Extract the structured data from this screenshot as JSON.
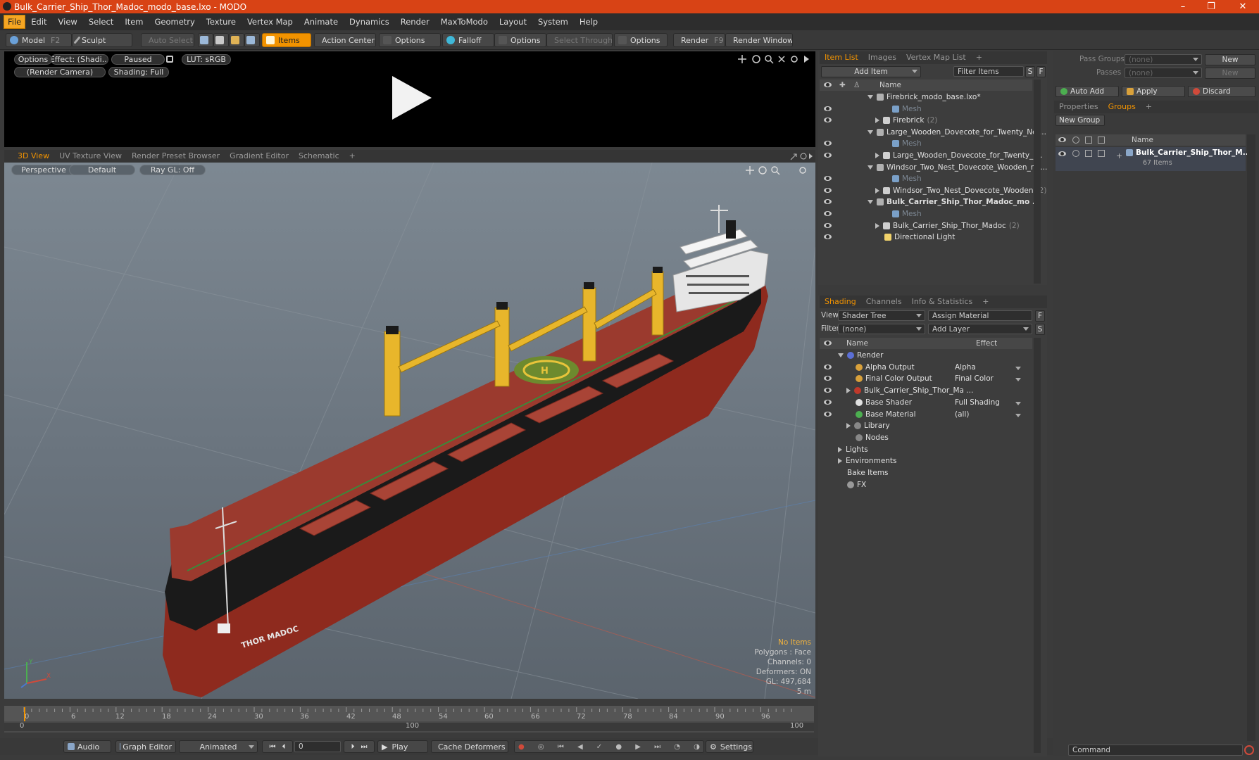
{
  "window": {
    "title": "Bulk_Carrier_Ship_Thor_Madoc_modo_base.lxo - MODO",
    "controls": [
      "–",
      "❐",
      "✕"
    ]
  },
  "menu": [
    "File",
    "Edit",
    "View",
    "Select",
    "Item",
    "Geometry",
    "Texture",
    "Vertex Map",
    "Animate",
    "Dynamics",
    "Render",
    "MaxToModo",
    "Layout",
    "System",
    "Help"
  ],
  "toolbar": {
    "model": "Model",
    "model_key": "F2",
    "sculpt": "Sculpt",
    "auto_select": "Auto Select",
    "items": "Items",
    "action_center": "Action Center",
    "options1": "Options",
    "falloff": "Falloff",
    "options2": "Options",
    "select_through": "Select Through",
    "options3": "Options",
    "render": "Render",
    "render_key": "F9",
    "render_window": "Render Window"
  },
  "preview": {
    "options": "Options",
    "effect": "Effect: (Shadi...",
    "paused": "Paused",
    "lut": "LUT: sRGB",
    "camera": "(Render Camera)",
    "shading": "Shading: Full"
  },
  "view_tabs": [
    "3D View",
    "UV Texture View",
    "Render Preset Browser",
    "Gradient Editor",
    "Schematic",
    "+"
  ],
  "viewport": {
    "perspective": "Perspective",
    "default": "Default",
    "raygl": "Ray GL: Off",
    "ship_name": "THOR MADOC",
    "stats": {
      "no_items": "No Items",
      "polygons": "Polygons : Face",
      "channels": "Channels: 0",
      "deformers": "Deformers: ON",
      "gl": "GL: 497,684",
      "scale": "5 m"
    },
    "axis": {
      "y": "Y",
      "x": "X"
    }
  },
  "timeline": {
    "ticks": [
      "0",
      "6",
      "12",
      "18",
      "24",
      "30",
      "36",
      "42",
      "48",
      "54",
      "60",
      "66",
      "72",
      "78",
      "84",
      "90",
      "96"
    ],
    "range_start": "0",
    "range_mid": "100",
    "range_end": "100"
  },
  "bottombar": {
    "audio": "Audio",
    "graph_editor": "Graph Editor",
    "animated": "Animated",
    "frame": "0",
    "play": "Play",
    "cache_deformers": "Cache Deformers",
    "settings": "Settings"
  },
  "item_list": {
    "tabs": [
      "Item List",
      "Images",
      "Vertex Map List",
      "+"
    ],
    "add_item": "Add Item",
    "filter_items": "Filter Items",
    "s": "S",
    "f": "F",
    "col_name": "Name",
    "rows": [
      {
        "label": "Firebrick_modo_base.lxo*",
        "count": "",
        "level": 0,
        "type": "scene",
        "eye": false,
        "exp": "down"
      },
      {
        "label": "Mesh",
        "count": "",
        "level": 2,
        "type": "mesh",
        "eye": true,
        "exp": ""
      },
      {
        "label": "Firebrick",
        "count": "(2)",
        "level": 1,
        "type": "group",
        "eye": true,
        "exp": "right"
      },
      {
        "label": "Large_Wooden_Dovecote_for_Twenty_Ne ...",
        "count": "",
        "level": 0,
        "type": "scene",
        "eye": false,
        "exp": "down"
      },
      {
        "label": "Mesh",
        "count": "",
        "level": 2,
        "type": "mesh",
        "eye": true,
        "exp": ""
      },
      {
        "label": "Large_Wooden_Dovecote_for_Twenty_ ...",
        "count": "",
        "level": 1,
        "type": "group",
        "eye": true,
        "exp": "right"
      },
      {
        "label": "Windsor_Two_Nest_Dovecote_Wooden_m ...",
        "count": "",
        "level": 0,
        "type": "scene",
        "eye": false,
        "exp": "down"
      },
      {
        "label": "Mesh",
        "count": "",
        "level": 2,
        "type": "mesh",
        "eye": true,
        "exp": ""
      },
      {
        "label": "Windsor_Two_Nest_Dovecote_Wooden",
        "count": "(2)",
        "level": 1,
        "type": "group",
        "eye": true,
        "exp": "right"
      },
      {
        "label": "Bulk_Carrier_Ship_Thor_Madoc_mo ...",
        "count": "",
        "level": 0,
        "type": "scene",
        "eye": true,
        "exp": "down",
        "bold": true
      },
      {
        "label": "Mesh",
        "count": "",
        "level": 2,
        "type": "mesh",
        "eye": true,
        "exp": ""
      },
      {
        "label": "Bulk_Carrier_Ship_Thor_Madoc",
        "count": "(2)",
        "level": 1,
        "type": "group",
        "eye": true,
        "exp": "right"
      },
      {
        "label": "Directional Light",
        "count": "",
        "level": 1,
        "type": "light",
        "eye": true,
        "exp": ""
      }
    ]
  },
  "shading": {
    "tabs": [
      "Shading",
      "Channels",
      "Info & Statistics",
      "+"
    ],
    "view_label": "View",
    "view_value": "Shader Tree",
    "assign_material": "Assign Material",
    "f": "F",
    "filter_label": "Filter",
    "filter_value": "(none)",
    "add_layer": "Add Layer",
    "s": "S",
    "col_name": "Name",
    "col_effect": "Effect",
    "rows": [
      {
        "label": "Render",
        "effect": "",
        "level": 0,
        "eye": false,
        "exp": "down",
        "icon": "#5b6fd6"
      },
      {
        "label": "Alpha Output",
        "effect": "Alpha",
        "level": 1,
        "eye": true,
        "exp": "",
        "icon": "#d9a13b"
      },
      {
        "label": "Final Color Output",
        "effect": "Final Color",
        "level": 1,
        "eye": true,
        "exp": "",
        "icon": "#d9a13b"
      },
      {
        "label": "Bulk_Carrier_Ship_Thor_Ma ...",
        "effect": "",
        "level": 1,
        "eye": true,
        "exp": "right",
        "icon": "#c0392b"
      },
      {
        "label": "Base Shader",
        "effect": "Full Shading",
        "level": 1,
        "eye": true,
        "exp": "",
        "icon": "#e0e0e0"
      },
      {
        "label": "Base Material",
        "effect": "(all)",
        "level": 1,
        "eye": true,
        "exp": "",
        "icon": "#4caf50"
      },
      {
        "label": "Library",
        "effect": "",
        "level": 1,
        "eye": false,
        "exp": "right",
        "icon": "#888888"
      },
      {
        "label": "Nodes",
        "effect": "",
        "level": 1,
        "eye": false,
        "exp": "",
        "icon": "#888888"
      },
      {
        "label": "Lights",
        "effect": "",
        "level": 0,
        "eye": false,
        "exp": "right",
        "icon": ""
      },
      {
        "label": "Environments",
        "effect": "",
        "level": 0,
        "eye": false,
        "exp": "right",
        "icon": ""
      },
      {
        "label": "Bake Items",
        "effect": "",
        "level": 0,
        "eye": false,
        "exp": "",
        "icon": ""
      },
      {
        "label": "FX",
        "effect": "",
        "level": 0,
        "eye": false,
        "exp": "",
        "icon": "#999999"
      }
    ]
  },
  "right_panel": {
    "pass_groups": "Pass Groups",
    "pass_groups_value": "(none)",
    "new": "New",
    "passes": "Passes",
    "passes_value": "(none)",
    "new2": "New",
    "auto_add": "Auto Add",
    "apply": "Apply",
    "discard": "Discard",
    "tabs": [
      "Properties",
      "Groups",
      "+"
    ],
    "new_group": "New Group",
    "col_name": "Name",
    "group_name": "Bulk_Carrier_Ship_Thor_M...",
    "group_count": "67 Items",
    "command": "Command"
  },
  "colors": {
    "accent": "#f29300",
    "title": "#d84315",
    "hull": "#8e2a1e",
    "deck": "#9b3a2e",
    "crane": "#e8b62b"
  }
}
